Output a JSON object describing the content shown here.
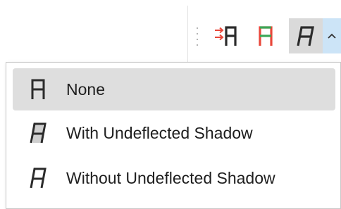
{
  "toolbar": {
    "buttons": [
      {
        "name": "align-right-letter",
        "icon": "letter-with-red-arrows-icon"
      },
      {
        "name": "colored-letter",
        "icon": "letter-red-green-icon"
      },
      {
        "name": "italic-letter-shadow",
        "icon": "italic-letter-icon",
        "selected": true
      }
    ],
    "dropdown_icon": "chevron-up-icon"
  },
  "menu": {
    "items": [
      {
        "label": "None",
        "icon": "letter-straight-icon",
        "highlighted": true
      },
      {
        "label": "With Undeflected Shadow",
        "icon": "letter-italic-shadow-icon",
        "highlighted": false
      },
      {
        "label": "Without Undeflected Shadow",
        "icon": "letter-italic-icon",
        "highlighted": false
      }
    ]
  },
  "colors": {
    "accent_red": "#e8473a",
    "accent_green": "#3aa757",
    "dropdown_bg": "#cce4f7",
    "highlight_bg": "#dedede",
    "icon_dark": "#2b2b2b"
  }
}
